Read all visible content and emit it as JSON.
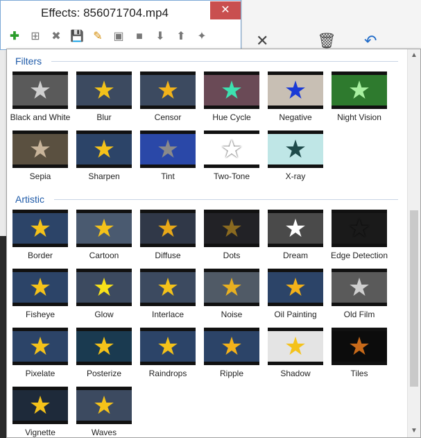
{
  "window": {
    "title": "Effects: 856071704.mp4",
    "close_label": "✕",
    "toolbar": [
      {
        "name": "add-effect-button",
        "icon": "plus-icon",
        "glyph": "✚",
        "cls": "add"
      },
      {
        "name": "add-group-button",
        "icon": "add-layer-icon",
        "glyph": "⊞",
        "cls": ""
      },
      {
        "name": "remove-button",
        "icon": "remove-icon",
        "glyph": "✖",
        "cls": ""
      },
      {
        "name": "save-button",
        "icon": "save-icon",
        "glyph": "💾",
        "cls": "save"
      },
      {
        "name": "edit-button",
        "icon": "pencil-icon",
        "glyph": "✎",
        "cls": "edit"
      },
      {
        "name": "copy-button",
        "icon": "copy-icon",
        "glyph": "▣",
        "cls": ""
      },
      {
        "name": "paste-button",
        "icon": "paste-icon",
        "glyph": "■",
        "cls": ""
      },
      {
        "name": "move-down-button",
        "icon": "arrow-down-icon",
        "glyph": "⬇",
        "cls": ""
      },
      {
        "name": "move-up-button",
        "icon": "arrow-up-icon",
        "glyph": "⬆",
        "cls": ""
      },
      {
        "name": "settings-button",
        "icon": "effects-icon",
        "glyph": "✦",
        "cls": ""
      }
    ]
  },
  "sections": [
    {
      "title": "Filters",
      "items": [
        {
          "label": "Black and White",
          "bg": "#5a5a5a",
          "star": "#cfcfcf"
        },
        {
          "label": "Blur",
          "bg": "#3c4a60",
          "star": "#f2c21a"
        },
        {
          "label": "Censor",
          "bg": "#3c4a60",
          "star": "#f2b31a"
        },
        {
          "label": "Hue Cycle",
          "bg": "#6a4a56",
          "star": "#3de2b0"
        },
        {
          "label": "Negative",
          "bg": "#c8bfb4",
          "star": "#1a3ad6"
        },
        {
          "label": "Night Vision",
          "bg": "#2e7a2e",
          "star": "#a8f0a0"
        },
        {
          "label": "Sepia",
          "bg": "#5a5040",
          "star": "#c8b49a"
        },
        {
          "label": "Sharpen",
          "bg": "#2c4468",
          "star": "#f4c21a"
        },
        {
          "label": "Tint",
          "bg": "#2a48a8",
          "star": "#8a8a8a"
        },
        {
          "label": "Two-Tone",
          "bg": "#ffffff",
          "star": "#ffffff"
        },
        {
          "label": "X-ray",
          "bg": "#bfe6e6",
          "star": "#1e4a4a"
        }
      ]
    },
    {
      "title": "Artistic",
      "items": [
        {
          "label": "Border",
          "bg": "#2c4468",
          "star": "#f4c21a"
        },
        {
          "label": "Cartoon",
          "bg": "#4a5a70",
          "star": "#f4c21a"
        },
        {
          "label": "Diffuse",
          "bg": "#303848",
          "star": "#e8a818"
        },
        {
          "label": "Dots",
          "bg": "#222226",
          "star": "#8a6a20"
        },
        {
          "label": "Dream",
          "bg": "#4a4a4a",
          "star": "#ffffff"
        },
        {
          "label": "Edge Detection",
          "bg": "#1a1a1a",
          "star": "#1a1a1a"
        },
        {
          "label": "Fisheye",
          "bg": "#2c4468",
          "star": "#f4c21a"
        },
        {
          "label": "Glow",
          "bg": "#3c4a60",
          "star": "#f8e21a"
        },
        {
          "label": "Interlace",
          "bg": "#3c4a60",
          "star": "#f4c21a"
        },
        {
          "label": "Noise",
          "bg": "#505a66",
          "star": "#e8b020"
        },
        {
          "label": "Oil Painting",
          "bg": "#2c4468",
          "star": "#f4b21a"
        },
        {
          "label": "Old Film",
          "bg": "#5a5a5a",
          "star": "#cfcfcf"
        },
        {
          "label": "Pixelate",
          "bg": "#2c4468",
          "star": "#f4c21a"
        },
        {
          "label": "Posterize",
          "bg": "#1a3a50",
          "star": "#f4c21a"
        },
        {
          "label": "Raindrops",
          "bg": "#2c4468",
          "star": "#f4c21a"
        },
        {
          "label": "Ripple",
          "bg": "#2c4468",
          "star": "#f4b21a"
        },
        {
          "label": "Shadow",
          "bg": "#e4e4e4",
          "star": "#f4c21a"
        },
        {
          "label": "Tiles",
          "bg": "#0c0c0c",
          "star": "#c86a1a"
        },
        {
          "label": "Vignette",
          "bg": "#1e2a3a",
          "star": "#f4c21a"
        },
        {
          "label": "Waves",
          "bg": "#3c4a60",
          "star": "#f4c21a"
        }
      ]
    }
  ]
}
